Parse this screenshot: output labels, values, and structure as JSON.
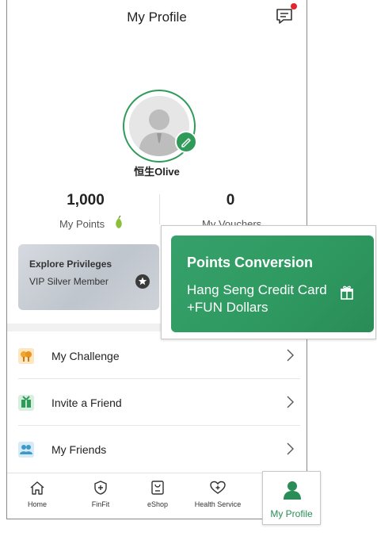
{
  "header": {
    "title": "My Profile"
  },
  "profile": {
    "username": "恒生Olive"
  },
  "stats": {
    "points_value": "1,000",
    "points_label": "My Points",
    "vouchers_value": "0",
    "vouchers_label": "My Vouchers"
  },
  "privileges": {
    "title": "Explore Privileges",
    "tier": "VIP Silver Member"
  },
  "points_conversion": {
    "title": "Points Conversion",
    "description": "Hang Seng Credit Card +FUN Dollars"
  },
  "list": [
    {
      "label": "My Challenge",
      "icon": "challenge-icon"
    },
    {
      "label": "Invite a Friend",
      "icon": "invite-icon"
    },
    {
      "label": "My Friends",
      "icon": "friends-icon"
    }
  ],
  "tabbar": [
    {
      "label": "Home",
      "icon": "home-icon"
    },
    {
      "label": "FinFit",
      "icon": "finfit-icon"
    },
    {
      "label": "eShop",
      "icon": "eshop-icon"
    },
    {
      "label": "Health Service",
      "icon": "health-icon"
    },
    {
      "label": "My Profile",
      "icon": "profile-icon"
    }
  ],
  "colors": {
    "accent": "#2f9b59",
    "notification": "#e3262c",
    "card_green": "#2f9b62"
  }
}
